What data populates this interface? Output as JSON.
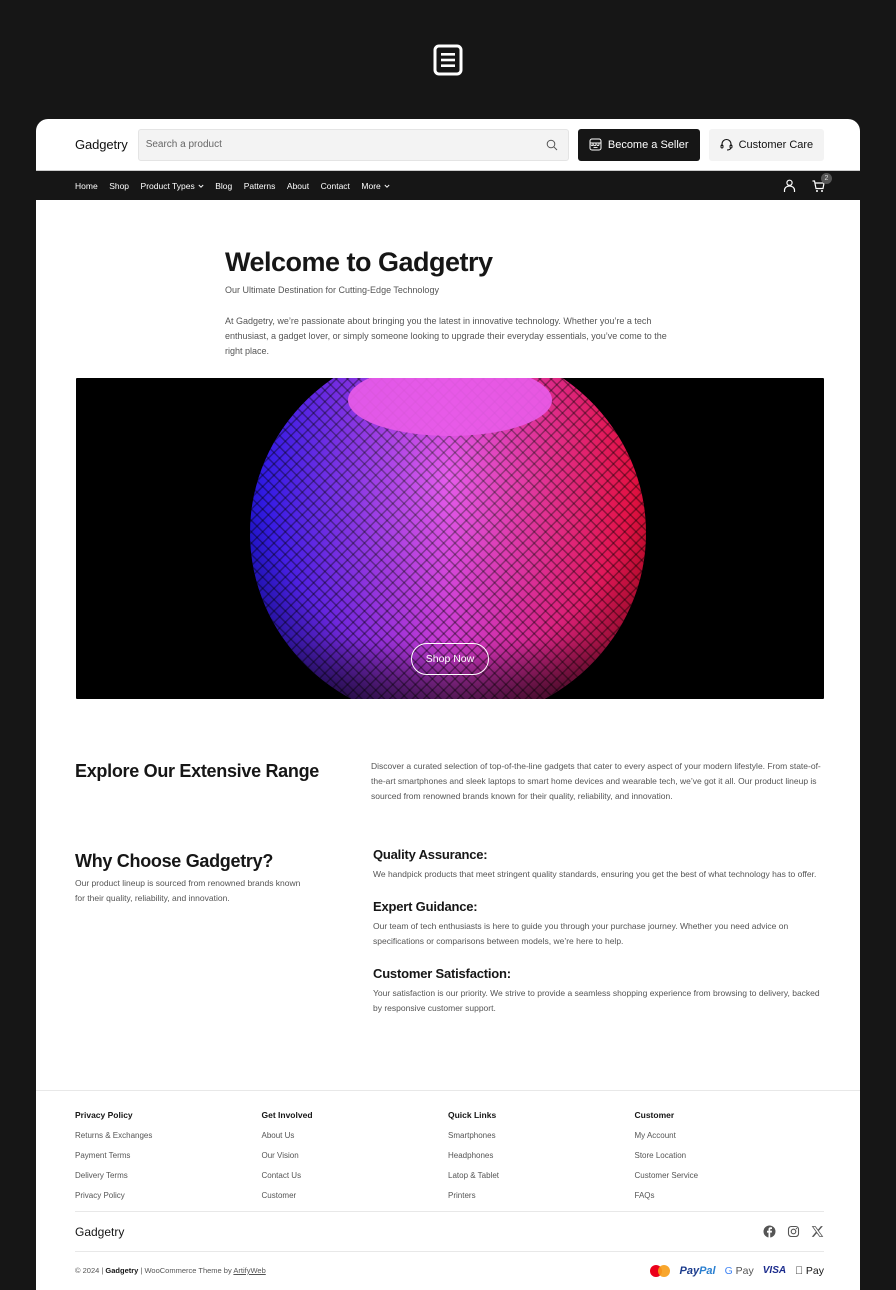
{
  "header": {
    "logo": "Gadgetry",
    "search_placeholder": "Search a product",
    "become_seller": "Become a Seller",
    "customer_care": "Customer Care"
  },
  "nav": {
    "items": [
      {
        "label": "Home",
        "has_dropdown": false
      },
      {
        "label": "Shop",
        "has_dropdown": false
      },
      {
        "label": "Product Types",
        "has_dropdown": true
      },
      {
        "label": "Blog",
        "has_dropdown": false
      },
      {
        "label": "Patterns",
        "has_dropdown": false
      },
      {
        "label": "About",
        "has_dropdown": false
      },
      {
        "label": "Contact",
        "has_dropdown": false
      },
      {
        "label": "More",
        "has_dropdown": true
      }
    ],
    "cart_count": "2"
  },
  "intro": {
    "title": "Welcome to Gadgetry",
    "subtitle": "Our Ultimate Destination for Cutting-Edge Technology",
    "body": "At Gadgetry, we’re passionate about bringing you the latest in innovative technology. Whether you’re a tech enthusiast, a gadget lover, or simply someone looking to upgrade their everyday essentials, you’ve come to the right place."
  },
  "hero": {
    "cta": "Shop Now",
    "colors": {
      "blue": "#2b1bff",
      "magenta": "#e040e8",
      "red": "#ff1040"
    }
  },
  "explore": {
    "title": "Explore Our Extensive Range",
    "body": "Discover a curated selection of top-of-the-line gadgets that cater to every aspect of your modern lifestyle. From state-of-the-art smartphones and sleek laptops to smart home devices and wearable tech, we’ve got it all. Our product lineup is sourced from renowned brands known for their quality, reliability, and innovation."
  },
  "why": {
    "title": "Why Choose Gadgetry?",
    "body": "Our product lineup is sourced from renowned brands known for their quality, reliability, and innovation.",
    "features": [
      {
        "title": "Quality Assurance:",
        "body": "We handpick products that meet stringent quality standards, ensuring you get the best of what technology has to offer."
      },
      {
        "title": "Expert Guidance:",
        "body": "Our team of tech enthusiasts is here to guide you through your purchase journey. Whether you need advice on specifications or comparisons between models, we’re here to help."
      },
      {
        "title": "Customer Satisfaction:",
        "body": "Your satisfaction is our priority. We strive to provide a seamless shopping experience from browsing to delivery, backed by responsive customer support."
      }
    ]
  },
  "footer": {
    "columns": [
      {
        "title": "Privacy Policy",
        "links": [
          "Returns & Exchanges",
          "Payment Terms",
          "Delivery Terms",
          "Privacy Policy"
        ]
      },
      {
        "title": "Get Involved",
        "links": [
          "About Us",
          "Our Vision",
          "Contact Us",
          "Customer"
        ]
      },
      {
        "title": "Quick Links",
        "links": [
          "Smartphones",
          "Headphones",
          "Latop & Tablet",
          "Printers"
        ]
      },
      {
        "title": "Customer",
        "links": [
          "My Account",
          "Store Location",
          "Customer Service",
          "FAQs"
        ]
      }
    ],
    "brand": "Gadgetry",
    "socials": [
      "facebook",
      "instagram",
      "x"
    ],
    "copyright_prefix": "© 2024 | ",
    "copyright_brand": "Gadgetry",
    "copyright_middle": " | WooCommerce Theme by ",
    "copyright_link": "ArtifyWeb",
    "payments": {
      "paypal_a": "Pay",
      "paypal_b": "Pal",
      "gpay_g": "G",
      "gpay_text": " Pay",
      "visa": "VISA",
      "applepay": " Pay"
    }
  }
}
